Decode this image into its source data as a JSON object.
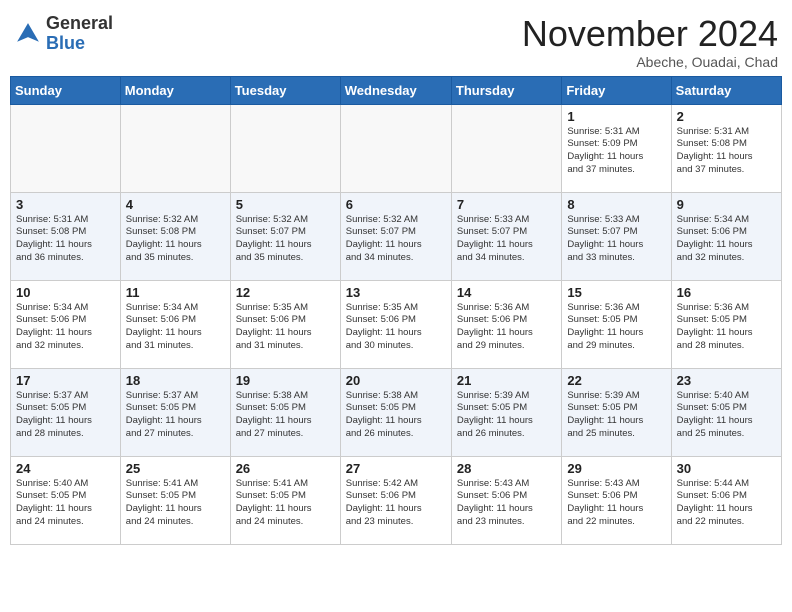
{
  "header": {
    "logo_general": "General",
    "logo_blue": "Blue",
    "month_title": "November 2024",
    "subtitle": "Abeche, Ouadai, Chad"
  },
  "days_of_week": [
    "Sunday",
    "Monday",
    "Tuesday",
    "Wednesday",
    "Thursday",
    "Friday",
    "Saturday"
  ],
  "weeks": [
    [
      {
        "day": "",
        "info": ""
      },
      {
        "day": "",
        "info": ""
      },
      {
        "day": "",
        "info": ""
      },
      {
        "day": "",
        "info": ""
      },
      {
        "day": "",
        "info": ""
      },
      {
        "day": "1",
        "info": "Sunrise: 5:31 AM\nSunset: 5:09 PM\nDaylight: 11 hours\nand 37 minutes."
      },
      {
        "day": "2",
        "info": "Sunrise: 5:31 AM\nSunset: 5:08 PM\nDaylight: 11 hours\nand 37 minutes."
      }
    ],
    [
      {
        "day": "3",
        "info": "Sunrise: 5:31 AM\nSunset: 5:08 PM\nDaylight: 11 hours\nand 36 minutes."
      },
      {
        "day": "4",
        "info": "Sunrise: 5:32 AM\nSunset: 5:08 PM\nDaylight: 11 hours\nand 35 minutes."
      },
      {
        "day": "5",
        "info": "Sunrise: 5:32 AM\nSunset: 5:07 PM\nDaylight: 11 hours\nand 35 minutes."
      },
      {
        "day": "6",
        "info": "Sunrise: 5:32 AM\nSunset: 5:07 PM\nDaylight: 11 hours\nand 34 minutes."
      },
      {
        "day": "7",
        "info": "Sunrise: 5:33 AM\nSunset: 5:07 PM\nDaylight: 11 hours\nand 34 minutes."
      },
      {
        "day": "8",
        "info": "Sunrise: 5:33 AM\nSunset: 5:07 PM\nDaylight: 11 hours\nand 33 minutes."
      },
      {
        "day": "9",
        "info": "Sunrise: 5:34 AM\nSunset: 5:06 PM\nDaylight: 11 hours\nand 32 minutes."
      }
    ],
    [
      {
        "day": "10",
        "info": "Sunrise: 5:34 AM\nSunset: 5:06 PM\nDaylight: 11 hours\nand 32 minutes."
      },
      {
        "day": "11",
        "info": "Sunrise: 5:34 AM\nSunset: 5:06 PM\nDaylight: 11 hours\nand 31 minutes."
      },
      {
        "day": "12",
        "info": "Sunrise: 5:35 AM\nSunset: 5:06 PM\nDaylight: 11 hours\nand 31 minutes."
      },
      {
        "day": "13",
        "info": "Sunrise: 5:35 AM\nSunset: 5:06 PM\nDaylight: 11 hours\nand 30 minutes."
      },
      {
        "day": "14",
        "info": "Sunrise: 5:36 AM\nSunset: 5:06 PM\nDaylight: 11 hours\nand 29 minutes."
      },
      {
        "day": "15",
        "info": "Sunrise: 5:36 AM\nSunset: 5:05 PM\nDaylight: 11 hours\nand 29 minutes."
      },
      {
        "day": "16",
        "info": "Sunrise: 5:36 AM\nSunset: 5:05 PM\nDaylight: 11 hours\nand 28 minutes."
      }
    ],
    [
      {
        "day": "17",
        "info": "Sunrise: 5:37 AM\nSunset: 5:05 PM\nDaylight: 11 hours\nand 28 minutes."
      },
      {
        "day": "18",
        "info": "Sunrise: 5:37 AM\nSunset: 5:05 PM\nDaylight: 11 hours\nand 27 minutes."
      },
      {
        "day": "19",
        "info": "Sunrise: 5:38 AM\nSunset: 5:05 PM\nDaylight: 11 hours\nand 27 minutes."
      },
      {
        "day": "20",
        "info": "Sunrise: 5:38 AM\nSunset: 5:05 PM\nDaylight: 11 hours\nand 26 minutes."
      },
      {
        "day": "21",
        "info": "Sunrise: 5:39 AM\nSunset: 5:05 PM\nDaylight: 11 hours\nand 26 minutes."
      },
      {
        "day": "22",
        "info": "Sunrise: 5:39 AM\nSunset: 5:05 PM\nDaylight: 11 hours\nand 25 minutes."
      },
      {
        "day": "23",
        "info": "Sunrise: 5:40 AM\nSunset: 5:05 PM\nDaylight: 11 hours\nand 25 minutes."
      }
    ],
    [
      {
        "day": "24",
        "info": "Sunrise: 5:40 AM\nSunset: 5:05 PM\nDaylight: 11 hours\nand 24 minutes."
      },
      {
        "day": "25",
        "info": "Sunrise: 5:41 AM\nSunset: 5:05 PM\nDaylight: 11 hours\nand 24 minutes."
      },
      {
        "day": "26",
        "info": "Sunrise: 5:41 AM\nSunset: 5:05 PM\nDaylight: 11 hours\nand 24 minutes."
      },
      {
        "day": "27",
        "info": "Sunrise: 5:42 AM\nSunset: 5:06 PM\nDaylight: 11 hours\nand 23 minutes."
      },
      {
        "day": "28",
        "info": "Sunrise: 5:43 AM\nSunset: 5:06 PM\nDaylight: 11 hours\nand 23 minutes."
      },
      {
        "day": "29",
        "info": "Sunrise: 5:43 AM\nSunset: 5:06 PM\nDaylight: 11 hours\nand 22 minutes."
      },
      {
        "day": "30",
        "info": "Sunrise: 5:44 AM\nSunset: 5:06 PM\nDaylight: 11 hours\nand 22 minutes."
      }
    ]
  ]
}
